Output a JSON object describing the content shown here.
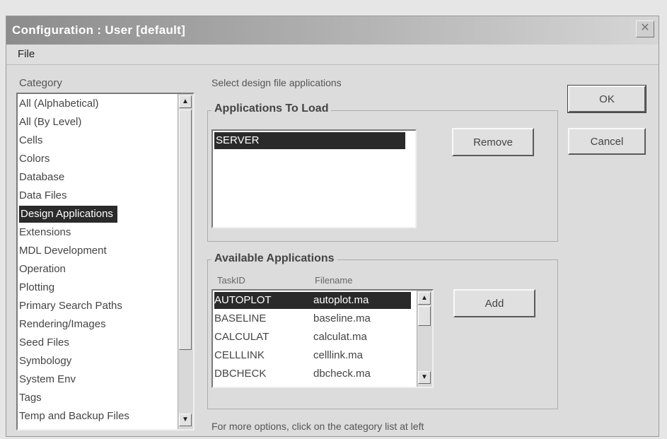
{
  "window": {
    "title": "Configuration : User [default]",
    "close_glyph": "✕"
  },
  "menu": {
    "file_label": "File"
  },
  "category": {
    "label": "Category",
    "items": [
      "All (Alphabetical)",
      "All (By Level)",
      "Cells",
      "Colors",
      "Database",
      "Data Files",
      "Design Applications",
      "Extensions",
      "MDL Development",
      "Operation",
      "Plotting",
      "Primary Search Paths",
      "Rendering/Images",
      "Seed Files",
      "Symbology",
      "System Env",
      "Tags",
      "Temp and Backup Files"
    ],
    "selected_item": "Design Applications"
  },
  "panel": {
    "description": "Select design file applications",
    "footer_hint": "For more options, click on the category list at left"
  },
  "apps_to_load": {
    "title": "Applications To Load",
    "items": [
      "SERVER"
    ],
    "selected_item": "SERVER",
    "remove_label": "Remove"
  },
  "available_apps": {
    "title": "Available Applications",
    "col_taskid": "TaskID",
    "col_filename": "Filename",
    "rows": [
      {
        "taskid": "AUTOPLOT",
        "filename": "autoplot.ma"
      },
      {
        "taskid": "BASELINE",
        "filename": "baseline.ma"
      },
      {
        "taskid": "CALCULAT",
        "filename": "calculat.ma"
      },
      {
        "taskid": "CELLLINK",
        "filename": "celllink.ma"
      },
      {
        "taskid": "DBCHECK",
        "filename": "dbcheck.ma"
      }
    ],
    "selected_taskid": "AUTOPLOT",
    "add_label": "Add"
  },
  "buttons": {
    "ok_label": "OK",
    "cancel_label": "Cancel"
  },
  "icons": {
    "scroll_up": "scroll-up-arrow-icon",
    "scroll_down": "scroll-down-arrow-icon",
    "close": "close-icon"
  }
}
